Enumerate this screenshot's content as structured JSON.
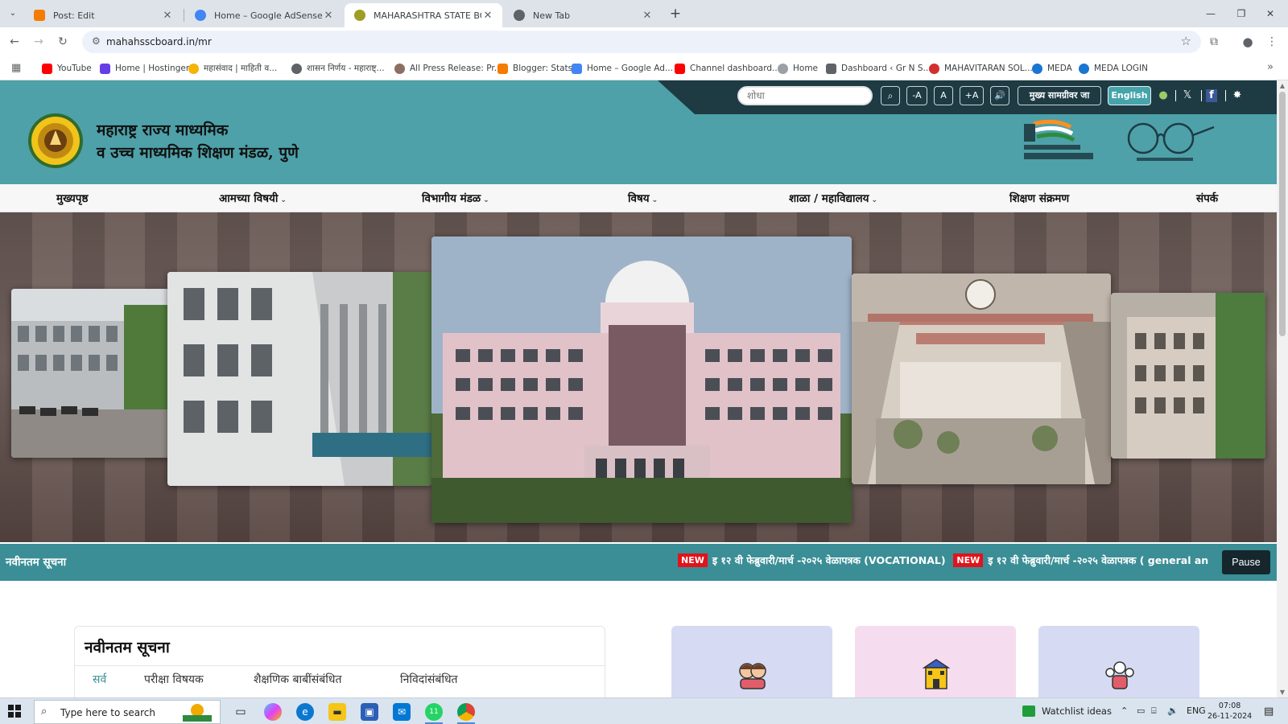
{
  "browser": {
    "tabs": [
      {
        "title": "Post: Edit",
        "icon": "blogger-icon",
        "color": "#f57c00"
      },
      {
        "title": "Home – Google AdSense",
        "icon": "adsense-icon",
        "color": "#4285f4"
      },
      {
        "title": "MAHARASHTRA STATE BOARD",
        "icon": "board-icon",
        "color": "#9e9d24",
        "active": true
      },
      {
        "title": "New Tab",
        "icon": "chrome-icon",
        "color": "#5f6368"
      }
    ],
    "url": "mahahsscboard.in/mr",
    "bookmarks": [
      {
        "label": "YouTube",
        "color": "#ff0000"
      },
      {
        "label": "Home | Hostinger",
        "color": "#673de6"
      },
      {
        "label": "महासंवाद | माहिती व...",
        "color": "#f4b400"
      },
      {
        "label": "शासन निर्णय - महाराष्ट्...",
        "color": "#5f6368"
      },
      {
        "label": "All Press Release: Pr...",
        "color": "#8d6e63"
      },
      {
        "label": "Blogger: Stats",
        "color": "#f57c00"
      },
      {
        "label": "Home – Google Ad...",
        "color": "#4285f4"
      },
      {
        "label": "Channel dashboard...",
        "color": "#ff0000"
      },
      {
        "label": "Home",
        "color": "#9aa0a6"
      },
      {
        "label": "Dashboard ‹ Gr N S...",
        "color": "#5f6368"
      },
      {
        "label": "MAHAVITARAN SOL...",
        "color": "#d32f2f"
      },
      {
        "label": "MEDA",
        "color": "#1976d2"
      },
      {
        "label": "MEDA LOGIN",
        "color": "#1976d2"
      }
    ]
  },
  "site": {
    "search_placeholder": "शोधा",
    "font_minus": "-A",
    "font_normal": "A",
    "font_plus": "+A",
    "skip_to_main": "मुख्य सामग्रीवर जा",
    "language": "English",
    "org_line1": "महाराष्ट्र राज्य माध्यमिक",
    "org_line2": "व उच्च माध्यमिक शिक्षण मंडळ, पुणे",
    "nav": [
      {
        "label": "मुख्यपृष्ठ",
        "dropdown": false
      },
      {
        "label": "आमच्या विषयी",
        "dropdown": true
      },
      {
        "label": "विभागीय मंडळ",
        "dropdown": true
      },
      {
        "label": "विषय",
        "dropdown": true
      },
      {
        "label": "शाळा / महाविद्यालय",
        "dropdown": true
      },
      {
        "label": "शिक्षण संक्रमण",
        "dropdown": false
      },
      {
        "label": "संपर्क",
        "dropdown": false
      }
    ],
    "ticker": {
      "label": "नवीनतम सूचना",
      "badge": "NEW",
      "items": [
        "इ १२ वी फेब्रुवारी/मार्च -२०२५ वेळापत्रक (VOCATIONAL)",
        "इ १२ वी फेब्रुवारी/मार्च -२०२५ वेळापत्रक ( general an"
      ],
      "pause_label": "Pause"
    },
    "notices": {
      "title": "नवीनतम सूचना",
      "tabs": [
        "सर्व",
        "परीक्षा विषयक",
        "शैक्षणिक बाबींसंबंधित",
        "निविदांसंबंधित"
      ]
    },
    "quick_cards": [
      {
        "icon": "students-icon",
        "color": "#d6dbf3"
      },
      {
        "icon": "school-icon",
        "color": "#f6dcef"
      },
      {
        "icon": "teachers-icon",
        "color": "#d6dbf3"
      }
    ]
  },
  "taskbar": {
    "search_placeholder": "Type here to search",
    "widget": "Watchlist ideas",
    "lang": "ENG",
    "time": "07:08",
    "date": "26-11-2024",
    "whatsapp_count": "11"
  }
}
